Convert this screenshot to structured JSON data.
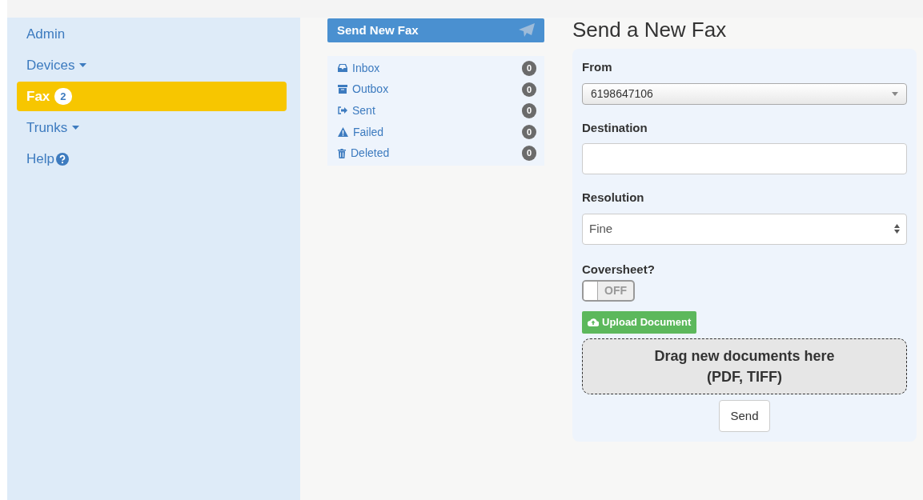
{
  "sidebar": {
    "items": [
      {
        "label": "Admin",
        "selected": false
      },
      {
        "label": "Devices",
        "selected": false,
        "dropdown": true
      },
      {
        "label": "Fax",
        "selected": true,
        "badge": "2"
      },
      {
        "label": "Trunks",
        "selected": false,
        "dropdown": true
      },
      {
        "label": "Help",
        "selected": false,
        "help": true
      }
    ]
  },
  "send_button": {
    "label": "Send New Fax"
  },
  "folders": [
    {
      "label": "Inbox",
      "count": "0",
      "kind": "inbox"
    },
    {
      "label": "Outbox",
      "count": "0",
      "kind": "outbox"
    },
    {
      "label": "Sent",
      "count": "0",
      "kind": "sent"
    },
    {
      "label": "Failed",
      "count": "0",
      "kind": "failed"
    },
    {
      "label": "Deleted",
      "count": "0",
      "kind": "deleted"
    }
  ],
  "form": {
    "title": "Send a New Fax",
    "from": {
      "label": "From",
      "value": "6198647106"
    },
    "destination": {
      "label": "Destination"
    },
    "resolution": {
      "label": "Resolution",
      "value": "Fine"
    },
    "coversheet": {
      "label": "Coversheet?",
      "on": false,
      "text": "OFF"
    },
    "upload_button": "Upload Document",
    "drop_zone": "Drag new documents here\n(PDF, TIFF)",
    "send": "Send"
  }
}
